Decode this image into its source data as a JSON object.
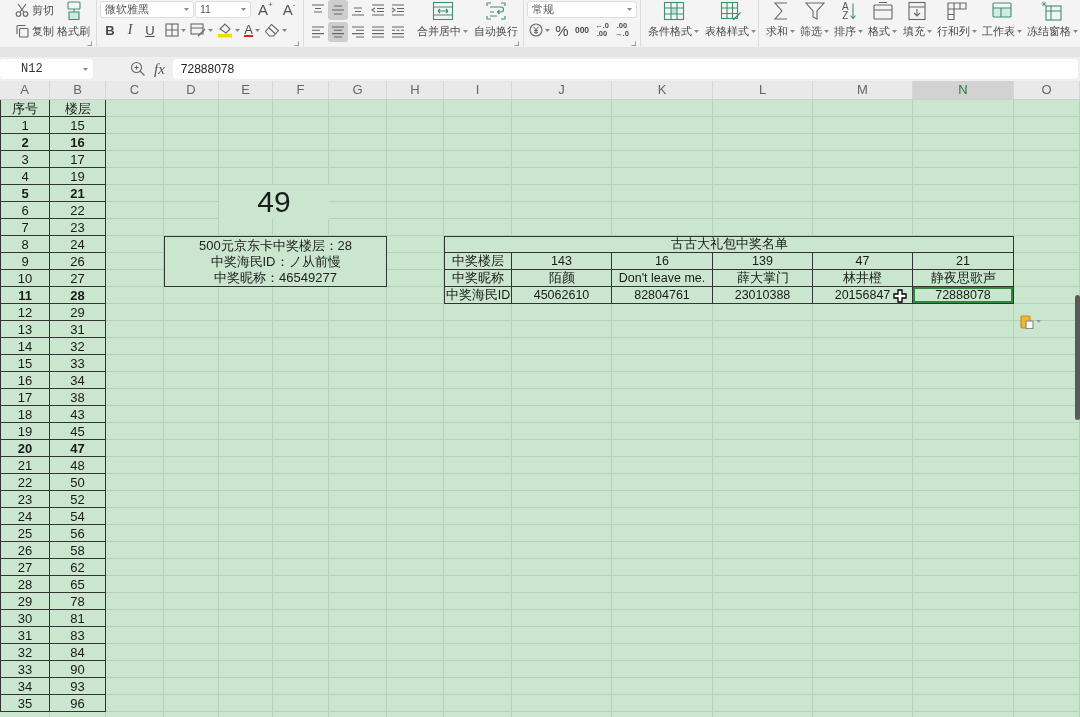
{
  "ribbon": {
    "clipboard": {
      "small": [
        {
          "label": "剪切"
        },
        {
          "label": "复制"
        }
      ],
      "large": {
        "label": "格式刷"
      }
    },
    "font": {
      "name_field": "微软雅黑",
      "size_field": "11",
      "size_buttons": [
        "A$^{+}$",
        "A$^{-}$"
      ],
      "tools": [
        {
          "label": "B",
          "dropdown": false
        },
        {
          "label": "I",
          "dropdown": false
        },
        {
          "label": "U",
          "dropdown": false
        },
        {
          "dropdown": true
        },
        {
          "dropdown": true
        },
        {
          "dropdown": true
        },
        {
          "label": "A",
          "dropdown": true
        },
        {
          "dropdown": true
        }
      ]
    },
    "alignment": {
      "rows": [
        [
          {
            "selected": false
          },
          {
            "selected": true
          },
          {
            "selected": false
          },
          {
            "selected": false
          },
          {
            "selected": false
          }
        ],
        [
          {
            "selected": false
          },
          {
            "selected": true
          },
          {
            "selected": false
          },
          {
            "selected": false
          },
          {
            "selected": false
          }
        ]
      ],
      "large": [
        {
          "label": "合并居中",
          "dropdown": true
        },
        {
          "label": "自动换行",
          "dropdown": false
        }
      ]
    },
    "number": {
      "format_field": "常规",
      "tools": [
        {
          "dropdown": true
        },
        {
          "label": "%"
        },
        {
          "label": "000"
        },
        {
          "lines": [
            "←.0",
            ".00"
          ]
        },
        {
          "lines": [
            ".00",
            "→.0"
          ]
        }
      ]
    },
    "styles": [
      {
        "label": "条件格式",
        "dropdown": true
      },
      {
        "label": "表格样式",
        "dropdown": true
      }
    ],
    "cells": [
      {
        "label": "求和",
        "dropdown": true
      },
      {
        "label": "筛选",
        "dropdown": true
      },
      {
        "label": "排序",
        "dropdown": true,
        "glyph_lines": [
          "A",
          "Z"
        ]
      },
      {
        "label": "格式",
        "dropdown": true
      },
      {
        "label": "填充",
        "dropdown": true
      },
      {
        "label": "行和列",
        "dropdown": true
      },
      {
        "label": "工作表",
        "dropdown": true
      },
      {
        "label": "冻结窗格",
        "dropdown": true
      }
    ]
  },
  "formula_bar": {
    "name_box": "N12",
    "function_label": "fx",
    "formula": "72888078"
  },
  "sheet": {
    "columns": [
      {
        "label": "A",
        "selected": false
      },
      {
        "label": "B",
        "selected": false
      },
      {
        "label": "C",
        "selected": false
      },
      {
        "label": "D",
        "selected": false
      },
      {
        "label": "E",
        "selected": false
      },
      {
        "label": "F",
        "selected": false
      },
      {
        "label": "G",
        "selected": false
      },
      {
        "label": "H",
        "selected": false
      },
      {
        "label": "I",
        "selected": false
      },
      {
        "label": "J",
        "selected": false
      },
      {
        "label": "K",
        "selected": false
      },
      {
        "label": "L",
        "selected": false
      },
      {
        "label": "M",
        "selected": false
      },
      {
        "label": "N",
        "selected": true
      },
      {
        "label": "O",
        "selected": false
      }
    ],
    "list": {
      "headers": [
        "序号",
        "楼层"
      ],
      "rows": [
        {
          "cells": [
            "1",
            "15"
          ],
          "bold": false
        },
        {
          "cells": [
            "2",
            "16"
          ],
          "bold": true
        },
        {
          "cells": [
            "3",
            "17"
          ],
          "bold": false
        },
        {
          "cells": [
            "4",
            "19"
          ],
          "bold": false
        },
        {
          "cells": [
            "5",
            "21"
          ],
          "bold": true
        },
        {
          "cells": [
            "6",
            "22"
          ],
          "bold": false
        },
        {
          "cells": [
            "7",
            "23"
          ],
          "bold": false
        },
        {
          "cells": [
            "8",
            "24"
          ],
          "bold": false
        },
        {
          "cells": [
            "9",
            "26"
          ],
          "bold": false
        },
        {
          "cells": [
            "10",
            "27"
          ],
          "bold": false
        },
        {
          "cells": [
            "11",
            "28"
          ],
          "bold": true
        },
        {
          "cells": [
            "12",
            "29"
          ],
          "bold": false
        },
        {
          "cells": [
            "13",
            "31"
          ],
          "bold": false
        },
        {
          "cells": [
            "14",
            "32"
          ],
          "bold": false
        },
        {
          "cells": [
            "15",
            "33"
          ],
          "bold": false
        },
        {
          "cells": [
            "16",
            "34"
          ],
          "bold": false
        },
        {
          "cells": [
            "17",
            "38"
          ],
          "bold": false
        },
        {
          "cells": [
            "18",
            "43"
          ],
          "bold": false
        },
        {
          "cells": [
            "19",
            "45"
          ],
          "bold": false
        },
        {
          "cells": [
            "20",
            "47"
          ],
          "bold": true
        },
        {
          "cells": [
            "21",
            "48"
          ],
          "bold": false
        },
        {
          "cells": [
            "22",
            "50"
          ],
          "bold": false
        },
        {
          "cells": [
            "23",
            "52"
          ],
          "bold": false
        },
        {
          "cells": [
            "24",
            "54"
          ],
          "bold": false
        },
        {
          "cells": [
            "25",
            "56"
          ],
          "bold": false
        },
        {
          "cells": [
            "26",
            "58"
          ],
          "bold": false
        },
        {
          "cells": [
            "27",
            "62"
          ],
          "bold": false
        },
        {
          "cells": [
            "28",
            "65"
          ],
          "bold": false
        },
        {
          "cells": [
            "29",
            "78"
          ],
          "bold": false
        },
        {
          "cells": [
            "30",
            "81"
          ],
          "bold": false
        },
        {
          "cells": [
            "31",
            "83"
          ],
          "bold": false
        },
        {
          "cells": [
            "32",
            "84"
          ],
          "bold": false
        },
        {
          "cells": [
            "33",
            "90"
          ],
          "bold": false
        },
        {
          "cells": [
            "34",
            "93"
          ],
          "bold": false
        },
        {
          "cells": [
            "35",
            "96"
          ],
          "bold": false
        }
      ]
    },
    "big_number": "49",
    "info_box": {
      "lines": [
        "500元京东卡中奖楼层：28",
        "中奖海民ID：ノ从前慢",
        "中奖昵称：46549277"
      ]
    },
    "prize_table": {
      "title": "古古大礼包中奖名单",
      "rows": [
        {
          "label": "中奖楼层",
          "cells": [
            {
              "text": "143",
              "selected": false
            },
            {
              "text": "16",
              "selected": false
            },
            {
              "text": "139",
              "selected": false
            },
            {
              "text": "47",
              "selected": false
            },
            {
              "text": "21",
              "selected": false
            }
          ]
        },
        {
          "label": "中奖昵称",
          "cells": [
            {
              "text": "陌颜",
              "selected": false
            },
            {
              "text": "Don't leave me.",
              "selected": false
            },
            {
              "text": "薛大掌门",
              "selected": false
            },
            {
              "text": "林井橙",
              "selected": false
            },
            {
              "text": "静夜思歌声",
              "selected": false
            }
          ]
        },
        {
          "label": "中奖海民ID",
          "cells": [
            {
              "text": "45062610",
              "selected": false
            },
            {
              "text": "82804761",
              "selected": false
            },
            {
              "text": "23010388",
              "selected": false
            },
            {
              "text": "20156847",
              "selected": false
            },
            {
              "text": "72888078",
              "selected": true
            }
          ]
        }
      ]
    }
  }
}
